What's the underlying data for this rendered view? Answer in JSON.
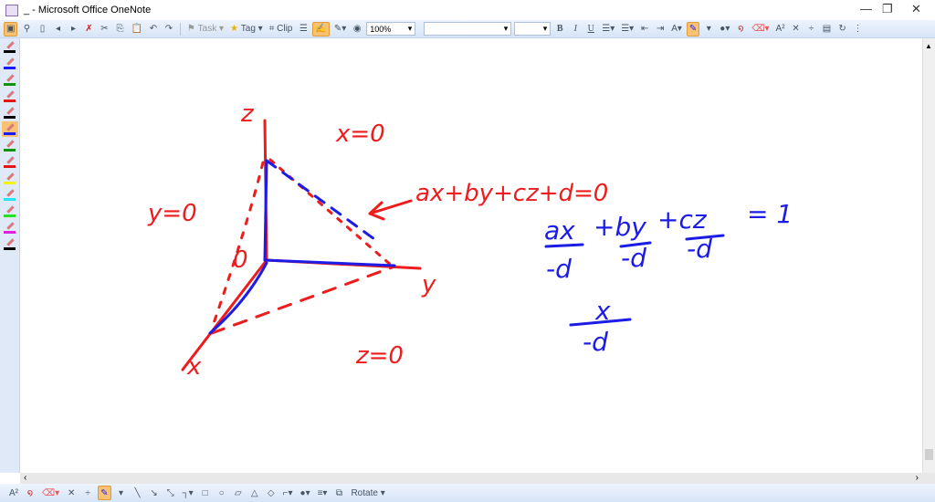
{
  "window": {
    "title": "_ - Microsoft Office OneNote",
    "minimize": "—",
    "restore": "❐",
    "close": "✕"
  },
  "toolbar": {
    "task": "Task",
    "tag": "Tag",
    "clip": "Clip",
    "zoom": "100%",
    "font": "",
    "size": "",
    "bold": "B",
    "italic": "I",
    "underline": "U",
    "superscript": "A²"
  },
  "pens": [
    {
      "color": "#000000"
    },
    {
      "color": "#1a1aff"
    },
    {
      "color": "#129312"
    },
    {
      "color": "#e01818"
    },
    {
      "color": "#000000"
    },
    {
      "color": "#1a1aff",
      "selected": true
    },
    {
      "color": "#129312"
    },
    {
      "color": "#e01818"
    },
    {
      "color": "#f2f21a"
    },
    {
      "color": "#25e6f0"
    },
    {
      "color": "#22e022"
    },
    {
      "color": "#e020e0"
    },
    {
      "color": "#000000"
    }
  ],
  "ink": {
    "red_color": "#ee1c1c",
    "blue_color": "#1c1ce6",
    "z_label": "z",
    "x_eq": "x=0",
    "plane_eq": "ax+by+cz+d=0",
    "y_eq": "y=0",
    "origin": "0",
    "y_label": "y",
    "x_label": "x",
    "z_eq": "z=0",
    "ax": "ax",
    "by": "+by",
    "cz": "+cz",
    "neg_d": "-d",
    "equals_one": "= 1",
    "x_num": "x"
  },
  "bottombar": {
    "rotate": "Rotate"
  }
}
